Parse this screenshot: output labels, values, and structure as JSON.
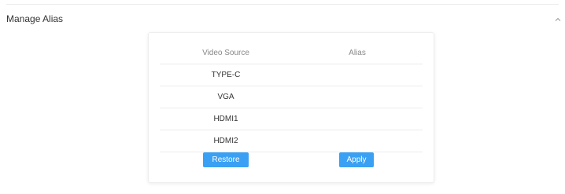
{
  "section": {
    "title": "Manage Alias",
    "collapse_icon": "chevron-up-icon"
  },
  "table": {
    "headers": {
      "source": "Video Source",
      "alias": "Alias"
    },
    "rows": [
      {
        "source": "TYPE-C",
        "alias": ""
      },
      {
        "source": "VGA",
        "alias": ""
      },
      {
        "source": "HDMI1",
        "alias": ""
      },
      {
        "source": "HDMI2",
        "alias": ""
      }
    ]
  },
  "actions": {
    "restore_label": "Restore",
    "apply_label": "Apply"
  },
  "colors": {
    "accent": "#3aa0f3",
    "text": "#333333",
    "header_text": "#888888",
    "divider": "#ececec"
  }
}
